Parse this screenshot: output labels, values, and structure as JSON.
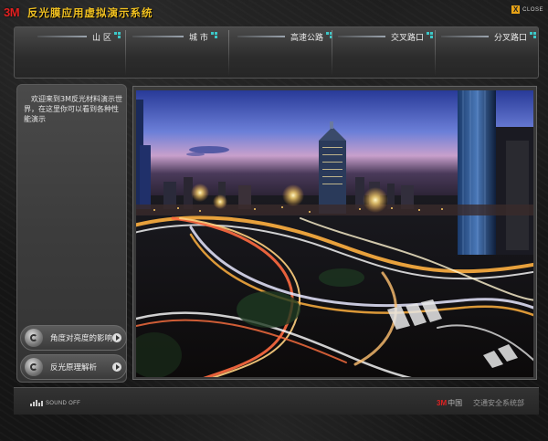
{
  "app": {
    "logo": "3M",
    "title": "反光膜应用虚拟演示系统",
    "close_label": "CLOSE",
    "close_symbol": "X"
  },
  "nav": {
    "items": [
      {
        "label": "山 区"
      },
      {
        "label": "城 市"
      },
      {
        "label": "高速公路"
      },
      {
        "label": "交叉路口"
      },
      {
        "label": "分叉路口"
      }
    ]
  },
  "side_panel": {
    "intro": "欢迎来到3M反光材料演示世界，在这里你可以看到各种性能演示",
    "buttons": [
      {
        "label": "角度对亮度的影响"
      },
      {
        "label": "反光原理解析"
      }
    ]
  },
  "photo": {
    "subject": "night-city-highway-interchange"
  },
  "footer": {
    "sound_label": "SOUND OFF",
    "brand_logo": "3M",
    "brand_region": "中国",
    "department": "交通安全系统部"
  },
  "colors": {
    "accent_yellow": "#f0c020",
    "brand_red": "#e02020",
    "nav_dot_cyan": "#3cc8c8",
    "close_orange": "#e8a316"
  }
}
